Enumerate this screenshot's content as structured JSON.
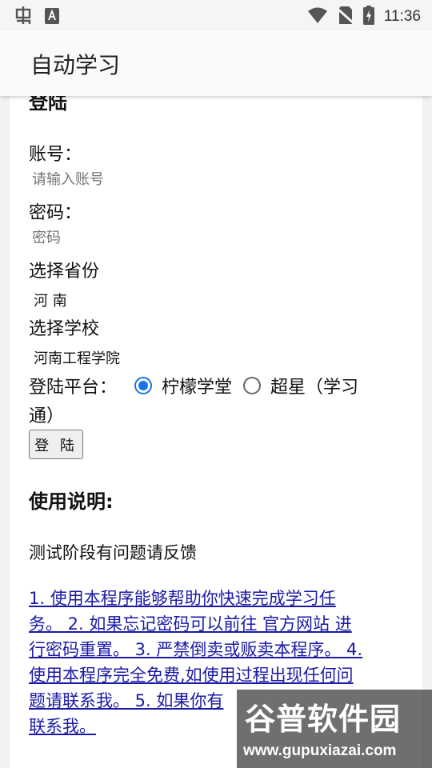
{
  "status_bar": {
    "time": "11:36",
    "icons": [
      "bug-icon",
      "a-icon",
      "wifi-icon",
      "no-sim-icon",
      "battery-charging-icon"
    ]
  },
  "app_bar": {
    "title": "自动学习"
  },
  "form": {
    "heading_partial": "登陆",
    "account_label": "账号：",
    "account_placeholder": "请输入账号",
    "password_label": "密码：",
    "password_placeholder": "密码",
    "province_label": "选择省份",
    "province_value": "河 南",
    "school_label": "选择学校",
    "school_value": "河南工程学院",
    "platform_label": "登陆平台：",
    "platform_options": [
      {
        "label": "柠檬学堂",
        "checked": true
      },
      {
        "label": "超星（学习",
        "checked": false
      }
    ],
    "platform_wrap": "通）",
    "login_button": "登 陆"
  },
  "usage": {
    "title": "使用说明:",
    "feedback": "测试阶段有问题请反馈",
    "lines": [
      "1. 使用本程序能够帮助你快速完成学习任",
      "务。 2. 如果忘记密码可以前往 官方网站 进",
      "行密码重置。 3. 严禁倒卖或贩卖本程序。 4.",
      "使用本程序完全免费,如使用过程出现任何问",
      "题请联系我。 5. 如果你有",
      "联系我。"
    ]
  },
  "watermark": {
    "title": "谷普软件园",
    "url": "www.gupuxiazai.com"
  }
}
